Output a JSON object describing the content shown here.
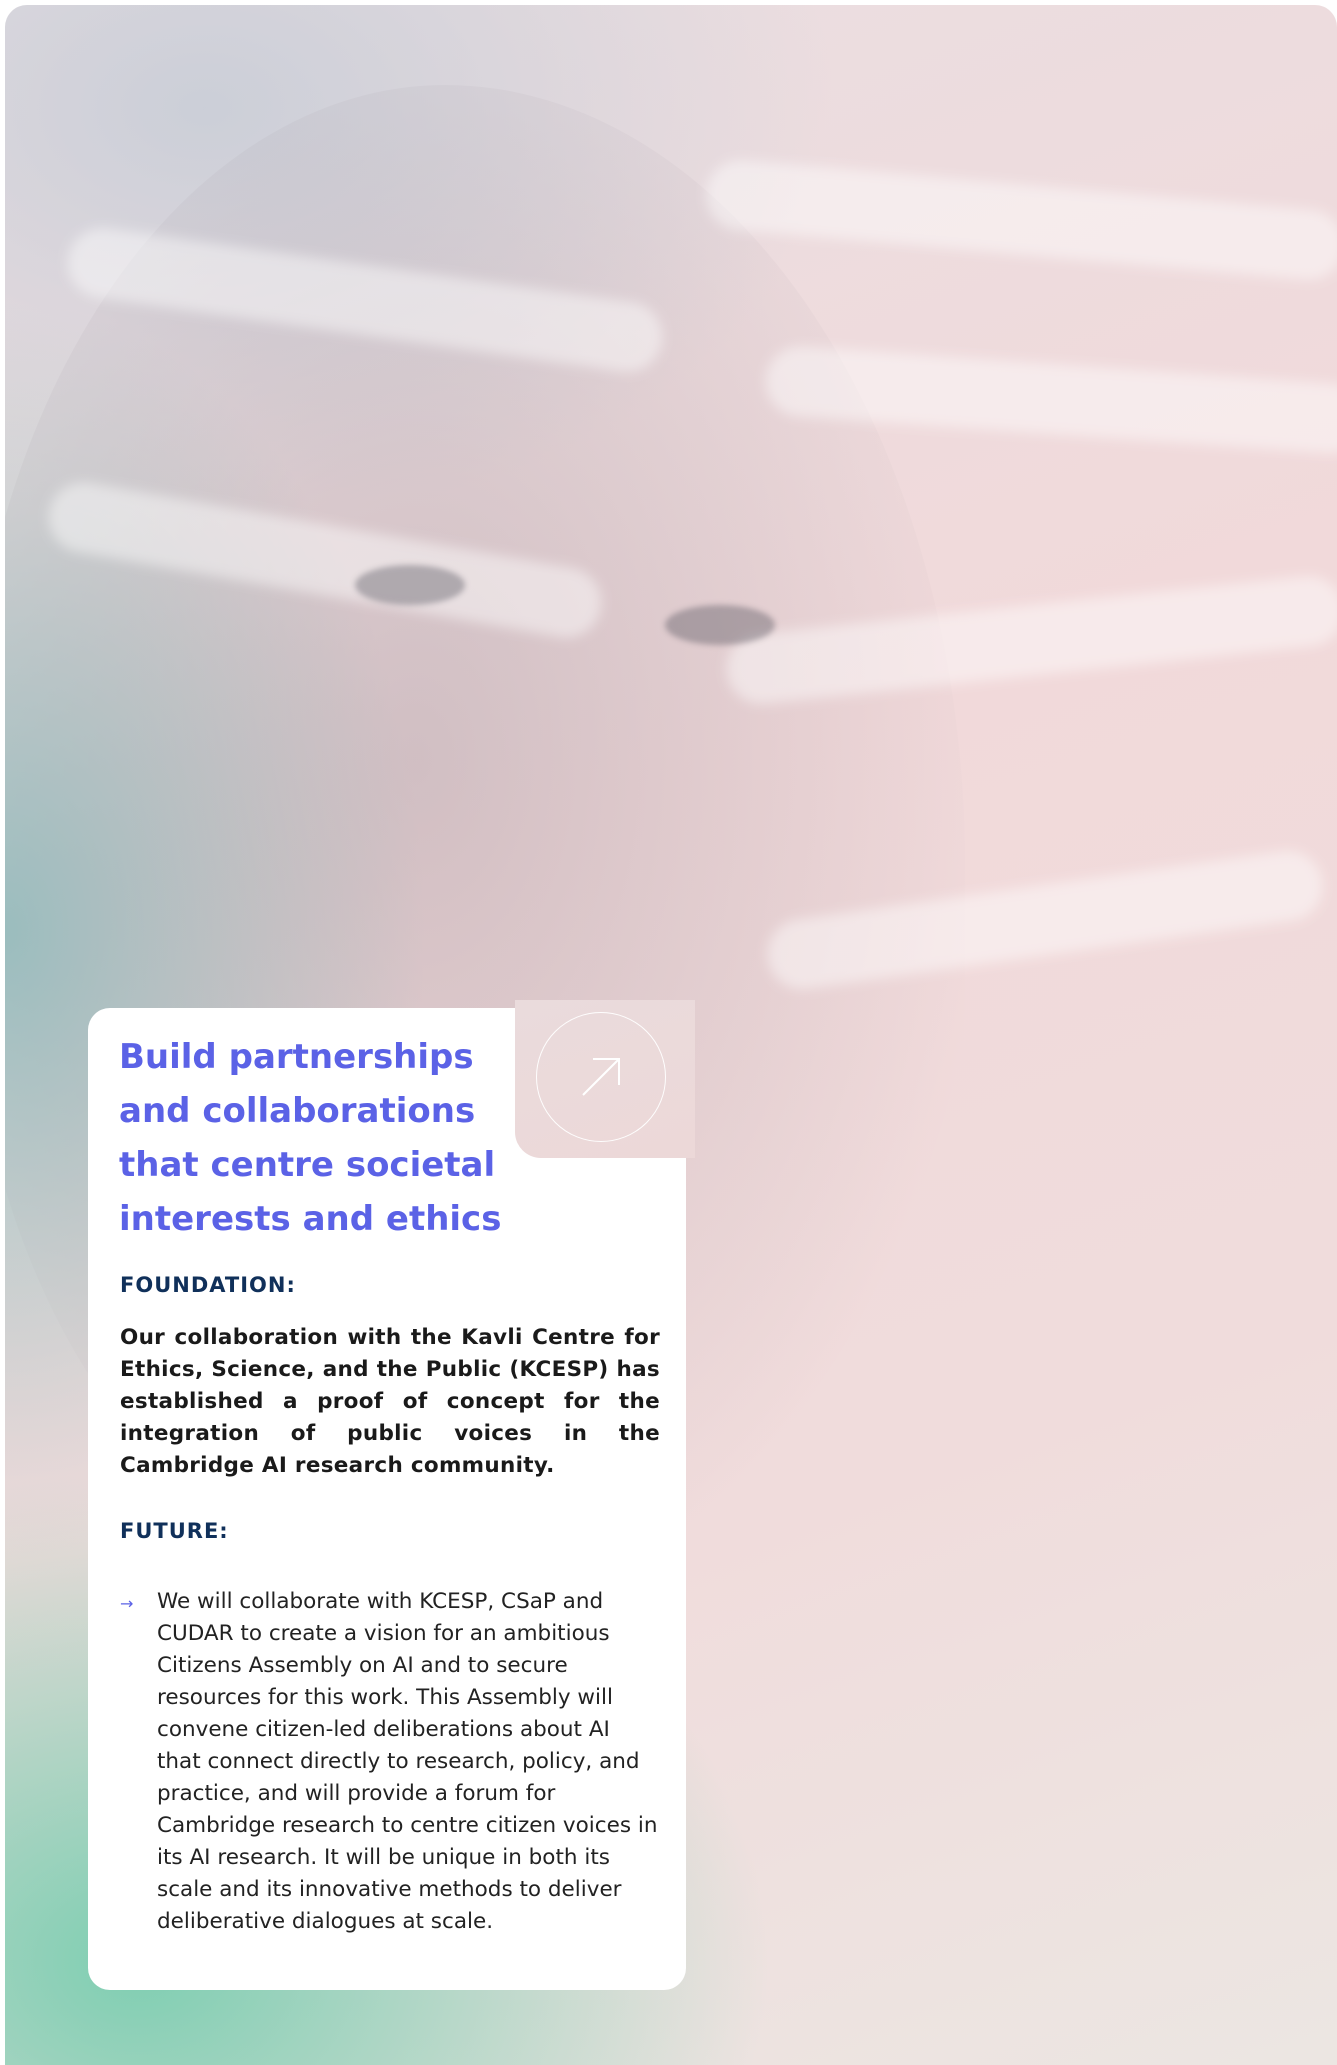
{
  "card": {
    "title": "Build partnerships\nand collaborations\nthat centre societal\ninterests and ethics",
    "foundation_label": "FOUNDATION:",
    "foundation_text": "Our collaboration with the Kavli Centre for Ethics, Science, and the Public (KCESP) has established a proof of concept for the integration of public voices in the Cambridge AI research community.",
    "future_label": "FUTURE:",
    "future_items": [
      "We will collaborate with KCESP, CSaP and CUDAR to create a vision for an ambitious Citizens Assembly on AI and to secure resources for this work. This Assembly will convene citizen-led deliberations about AI that connect directly to research, policy, and practice, and will provide a forum for Cambridge research to centre citizen voices in its AI research. It will be unique in both its scale and its innovative methods to deliver deliberative dialogues at scale."
    ],
    "bullet_icon": "arrow-right-icon",
    "link_icon": "arrow-up-right-icon"
  },
  "colors": {
    "title": "#5b62e6",
    "label": "#10305a",
    "bullet": "#5b62e6"
  }
}
